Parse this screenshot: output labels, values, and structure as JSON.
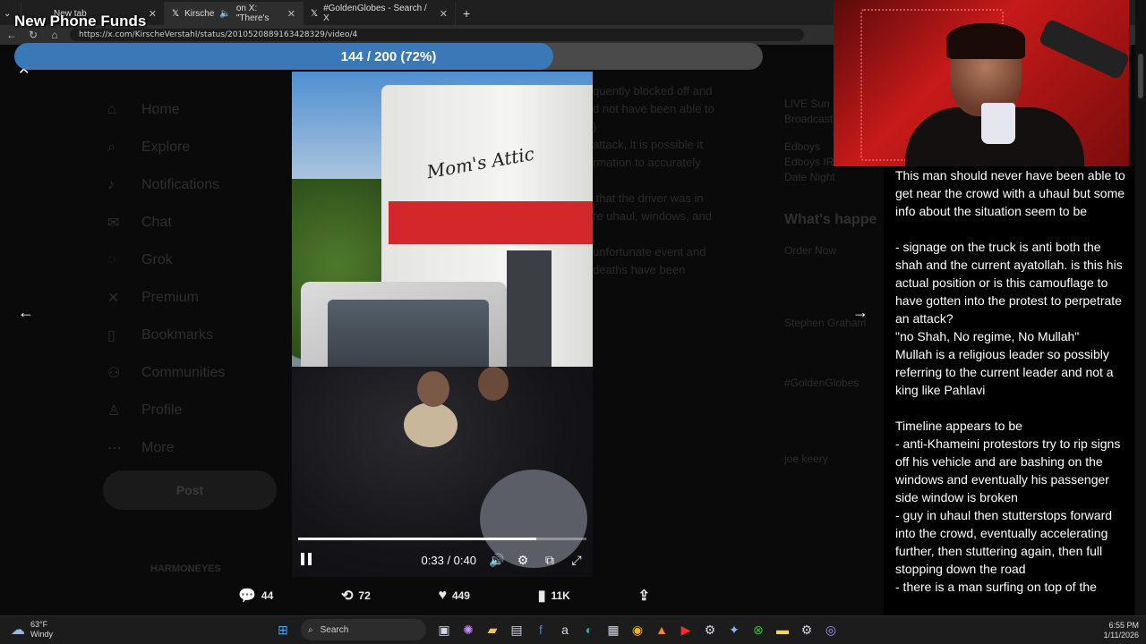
{
  "browser": {
    "tabs": [
      {
        "label": "New tab",
        "icon": "blank-tab-icon"
      },
      {
        "label": "Kirsche",
        "icon": "x-logo-icon"
      },
      {
        "label": "on X: \"There's",
        "icon": "audio-icon"
      },
      {
        "label": "#GoldenGlobes - Search / X",
        "icon": "x-logo-icon"
      }
    ],
    "url": "https://x.com/KirscheVerstahl/status/2010520889163428329/video/4"
  },
  "overlay": {
    "title": "New Phone Funds",
    "progress_label": "144 / 200 (72%)",
    "progress_fraction": 0.72
  },
  "background_page": {
    "nav": [
      "Home",
      "Explore",
      "Notifications",
      "Chat",
      "Grok",
      "Premium",
      "Bookmarks",
      "Communities",
      "Profile",
      "More"
    ],
    "post_label": "Post",
    "user": "HARMONEYES",
    "text": "quently blocked off and\nd not have been able to\n)\nattack, it is possible it\nrmation to accurately\n\n that the driver was in\nre uhaul, windows, and\n\nunfortunate event and\ndeaths have been",
    "right_items": [
      "LIVE Sun",
      "Broadcast",
      "Edboys",
      "Edboys IRL Show |",
      "Date Night"
    ],
    "right_heading": "What's happe",
    "right_more": [
      "Order Now",
      "Stephen Graham",
      "#GoldenGlobes",
      "joe keery"
    ]
  },
  "video": {
    "truck_text": "Mom's Attic",
    "time_label": "0:33 / 0:40",
    "played_fraction": 0.825
  },
  "actions": {
    "replies": "44",
    "reposts": "72",
    "likes": "449",
    "views": "11K"
  },
  "commentary": {
    "text": "This man should never have been able to get near the crowd with a uhaul but some info about the situation seem to be\n\n- signage on the truck is anti both the shah and the current ayatollah. is this his actual position or is this camouflage to have gotten into the protest to perpetrate an attack?\n\"no Shah, No regime, No Mullah\"\nMullah is a religious leader so possibly referring to the current leader and not a king like Pahlavi\n\nTimeline appears to be\n- anti-Khameini protestors try to rip signs off his vehicle and are bashing on the windows and eventually his passenger side window is broken\n- guy in uhaul then stutterstops forward into the crowd, eventually accelerating further, then stuttering again, then full stopping down the road\n- there is a man surfing on top of the"
  },
  "taskbar": {
    "temp": "63°F",
    "condition": "Windy",
    "search_label": "Search",
    "time": "6:55 PM",
    "date": "1/11/2026"
  },
  "colors": {
    "progress_fill": "#3b78b8",
    "webcam_red": "#c81a1a"
  }
}
